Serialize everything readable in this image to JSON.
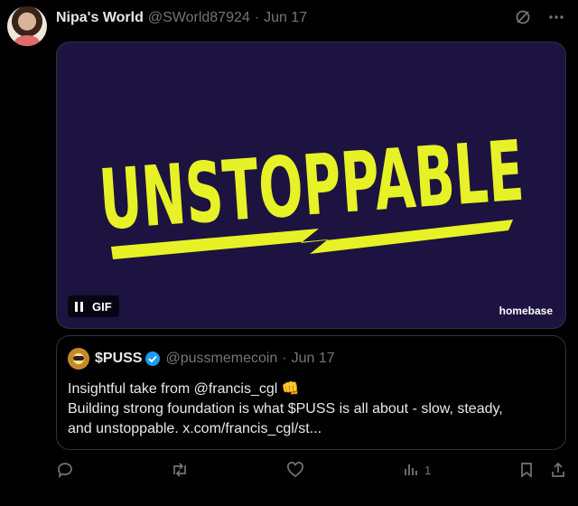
{
  "post": {
    "author_name": "Nipa's World",
    "author_handle": "@SWorld87924",
    "separator": "·",
    "date": "Jun 17"
  },
  "media": {
    "gif_text": "UNSTOPPABLE",
    "gif_label": "GIF",
    "watermark": "homebase",
    "accent_color": "#e7f226",
    "background_color": "#1d1340"
  },
  "quote": {
    "name": "$PUSS",
    "handle": "@pussmemecoin",
    "separator": "·",
    "date": "Jun 17",
    "line1": "Insightful take from @francis_cgl 👊",
    "line2": "Building strong foundation is what $PUSS is all about - slow, steady,",
    "line3": "and unstoppable. x.com/francis_cgl/st..."
  },
  "actions": {
    "reply_icon": "reply-icon",
    "repost_icon": "repost-icon",
    "like_icon": "heart-icon",
    "views_count": "1",
    "bookmark_icon": "bookmark-icon",
    "share_icon": "share-icon"
  },
  "colors": {
    "background": "#000000",
    "muted_text": "#71767b",
    "border": "#2f3336",
    "verified_blue": "#1d9bf0"
  }
}
